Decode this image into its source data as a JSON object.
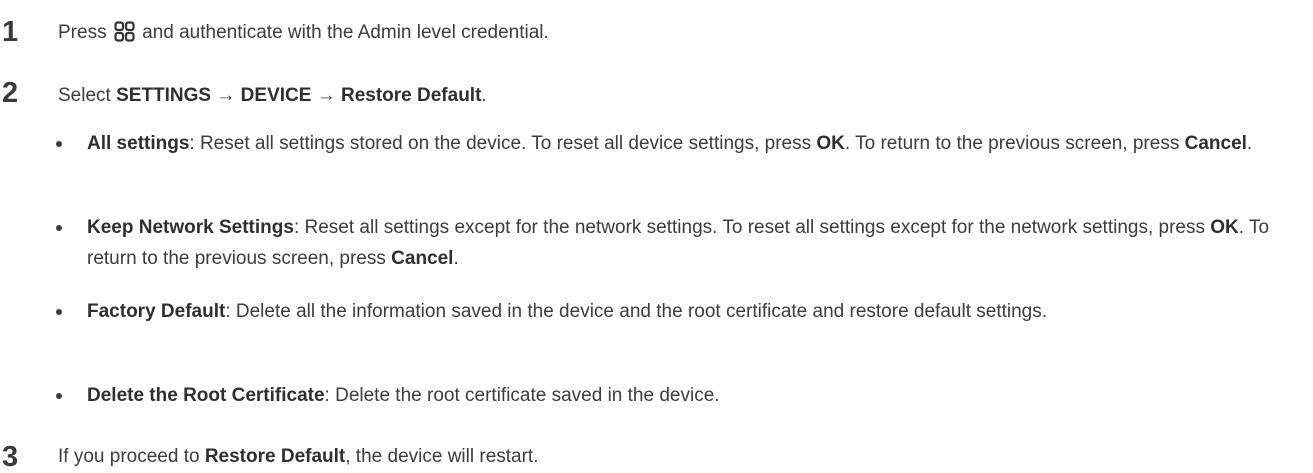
{
  "steps": [
    {
      "number": "1",
      "before": "Press",
      "icon": "grid-icon",
      "after": "and authenticate with the Admin level credential."
    },
    {
      "number": "2",
      "prefix": "Select",
      "path": [
        "SETTINGS",
        "DEVICE",
        "Restore Default"
      ],
      "arrow": "→",
      "suffix": "."
    },
    {
      "number": "3",
      "before": "If you proceed to",
      "bold": "Restore Default",
      "after": ", the device will restart."
    }
  ],
  "bullets": [
    {
      "title": "All settings",
      "text": ": Reset all settings stored on the device. To reset all device settings, press",
      "ok": "OK",
      "mid": ". To return to the previous screen, press",
      "cancel": "Cancel",
      "end": "."
    },
    {
      "title": "Keep Network Settings",
      "text": ": Reset all settings except for the network settings. To reset all settings except for the network settings, press",
      "ok": "OK",
      "mid": ". To return to the previous screen, press",
      "cancel": "Cancel",
      "end": "."
    },
    {
      "title": "Factory Default",
      "text": ": Delete all the information saved in the device and the root certificate and restore default settings."
    },
    {
      "title": "Delete the Root Certificate",
      "text": ": Delete the root certificate saved in the device."
    }
  ]
}
